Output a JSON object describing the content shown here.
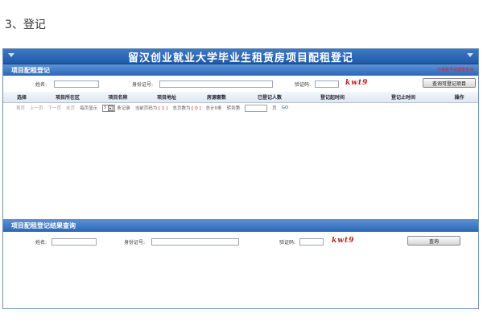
{
  "doc_heading": "3、登记",
  "title": "留汉创业就业大学毕业生租赁房项目配租登记",
  "section1": {
    "label": "项目配租登记",
    "red_link": "已有账号请登录查询",
    "name_label": "姓名:",
    "id_label": "身份证号:",
    "captcha_label": "验证码:",
    "captcha_text": "kwt9",
    "query_button": "查询可登记项目"
  },
  "table": {
    "headers": [
      "选择",
      "项目所在区",
      "项目名称",
      "项目地址",
      "房源套数",
      "已登记人数",
      "登记起时间",
      "登记止时间",
      "操作"
    ]
  },
  "pager": {
    "first": "首页",
    "prev": "上一页",
    "next": "下一页",
    "last": "末页",
    "per_page_label": "每页显示",
    "per_page_value": "5",
    "records_suffix": "条记录",
    "current_page_label": "当前页码为:",
    "current_page_value": "[ 1 ]",
    "total_pages_label": "总页数为:",
    "total_pages_value": "[ 0 ]",
    "total_label": "总计0条",
    "goto_label": "转到第",
    "page_suffix": "页",
    "go": "GO"
  },
  "section2": {
    "label": "项目配租登记结果查询",
    "name_label": "姓名:",
    "id_label": "身份证号:",
    "captcha_label": "验证码:",
    "captcha_text": "kwt9",
    "query_button": "查询"
  }
}
